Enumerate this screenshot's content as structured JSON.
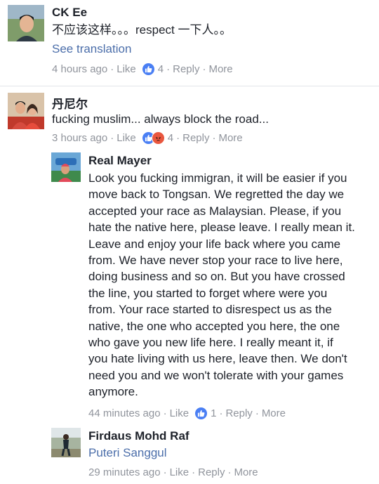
{
  "comments": [
    {
      "author": "CK Ee",
      "text": "不应该这样。。。respect 一下人。。",
      "see_translation": "See translation",
      "time": "4 hours ago",
      "like": "Like",
      "reaction_count": "4",
      "reply": "Reply",
      "more": "More"
    },
    {
      "author": "丹尼尔",
      "text": "fucking muslim... always block the road...",
      "time": "3 hours ago",
      "like": "Like",
      "reaction_count": "4",
      "reply": "Reply",
      "more": "More"
    }
  ],
  "replies": [
    {
      "author": "Real Mayer",
      "lines": [
        "Look you fucking immigran, it will be easier if you",
        "move back to Tongsan. We regretted the day we",
        "accepted your race as Malaysian. Please, if you",
        "hate the native here, please leave. I really mean it.",
        "Leave and enjoy your life back where you came",
        "from. We have never stop your race to live here,",
        "doing business and so on. But you have crossed",
        "the line, you started to forget where were you",
        "from. Your race started to disrespect us as the",
        "native, the one who accepted you here, the one",
        "who gave you new life here. I really meant it, if",
        "you hate living with us here, leave then. We don't",
        "need you and we won't tolerate with your games",
        "anymore."
      ],
      "time": "44 minutes ago",
      "like": "Like",
      "reaction_count": "1",
      "reply": "Reply",
      "more": "More"
    },
    {
      "author": "Firdaus Mohd Raf",
      "tag": "Puteri Sanggul",
      "time": "29 minutes ago",
      "like": "Like",
      "reply": "Reply",
      "more": "More"
    }
  ],
  "colors": {
    "link": "#4b6eaa",
    "meta": "#90949c",
    "like_reaction": "#4a7ff4",
    "angry_reaction": "#e9573f"
  },
  "icons": [
    "thumbs-up-icon",
    "angry-face-icon"
  ]
}
